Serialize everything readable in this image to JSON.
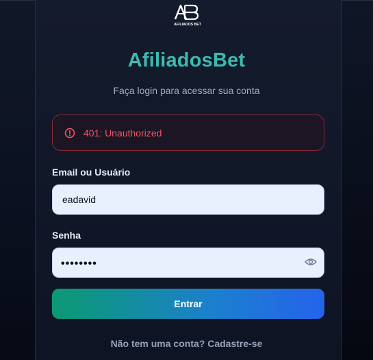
{
  "logo": {
    "icon": "afiliadosbet-logo-icon",
    "wordmark": "AFILIADOS BET"
  },
  "brand": {
    "name": "AfiliadosBet",
    "color": "#3dbab0"
  },
  "subtitle": "Faça login para acessar sua conta",
  "alert": {
    "icon": "alert-circle-icon",
    "message": "401: Unauthorized",
    "color": "#f05565"
  },
  "form": {
    "username": {
      "label": "Email ou Usuário",
      "value": "eadavid"
    },
    "password": {
      "label": "Senha",
      "masked_value": "••••••••",
      "toggle_icon": "eye-icon"
    },
    "submit_label": "Entrar"
  },
  "footer": {
    "signup_text": "Não tem uma conta? Cadastre-se"
  },
  "colors": {
    "button_gradient_start": "#0b9a72",
    "button_gradient_end": "#2563eb",
    "background": "#0b1120"
  }
}
